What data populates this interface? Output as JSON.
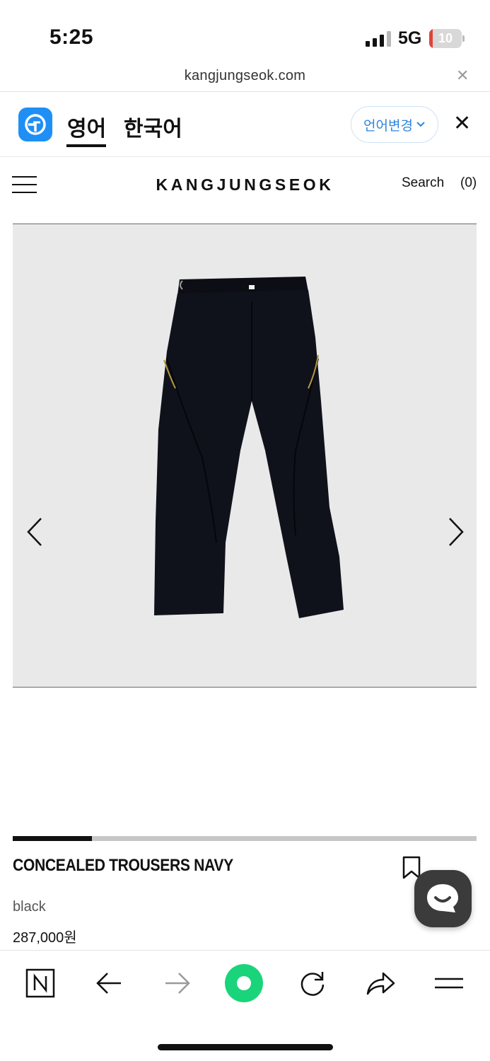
{
  "status_bar": {
    "time": "5:25",
    "network": "5G",
    "battery": "10"
  },
  "url_bar": {
    "url": "kangjungseok.com"
  },
  "translate_bar": {
    "tab_source": "영어",
    "tab_target": "한국어",
    "change_language": "언어변경"
  },
  "header": {
    "logo": "KANGJUNGSEOK",
    "search": "Search",
    "cart_count": "(0)"
  },
  "gallery": {
    "slide_progress": 0.17
  },
  "product": {
    "name": "CONCEALED TROUSERS NAVY",
    "color": "black",
    "price": "287,000원"
  },
  "colors": {
    "accent_blue": "#2d86e0",
    "papago_blue": "#1f8ff5",
    "naver_green": "#19d47b"
  }
}
